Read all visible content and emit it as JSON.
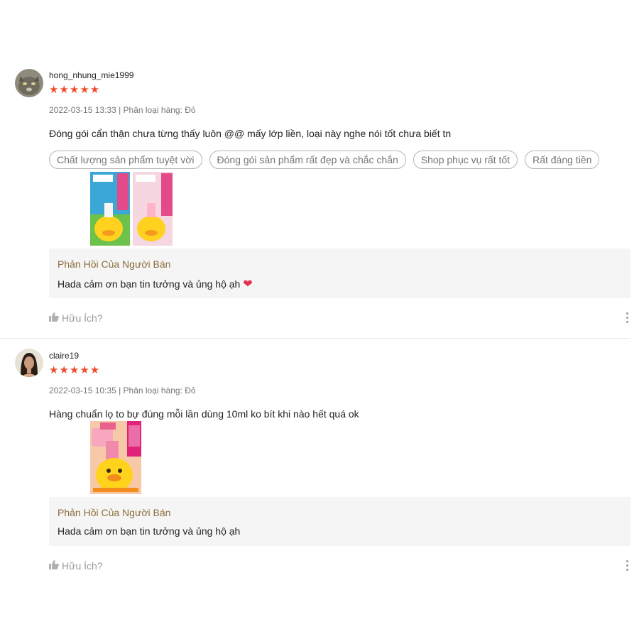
{
  "reviews": [
    {
      "username": "hong_nhung_mie1999",
      "stars": "★★★★★",
      "meta": "2022-03-15 13:33 | Phân loại hàng: Đỏ",
      "comment": "Đóng gói cẩn thận chưa từng thấy luôn @@ mấy lớp liền, loại này nghe nói tốt chưa biết tn",
      "tags": [
        "Chất lượng sản phẩm tuyệt vời",
        "Đóng gói sản phẩm rất đẹp và chắc chắn",
        "Shop phục vụ rất tốt",
        "Rất đáng tiền"
      ],
      "reply_title": "Phản Hồi Của Người Bán",
      "reply_text": "Hada cảm ơn bạn tin tưởng và ủng hộ ạh",
      "helpful": "Hữu Ích?"
    },
    {
      "username": "claire19",
      "stars": "★★★★★",
      "meta": "2022-03-15 10:35 | Phân loại hàng: Đỏ",
      "comment": "Hàng chuẩn lọ to bự đúng mỗi lần dùng 10ml ko bít khi nào hết quá ok",
      "reply_title": "Phản Hồi Của Người Bán",
      "reply_text": "Hada cảm ơn bạn tin tưởng và ủng hộ ạh",
      "helpful": "Hữu Ích?"
    }
  ],
  "colors": {
    "star": "#ee4d2d",
    "reply_bg": "#f5f5f5",
    "reply_title": "#8a6d3b",
    "heart": "#e0304e"
  }
}
